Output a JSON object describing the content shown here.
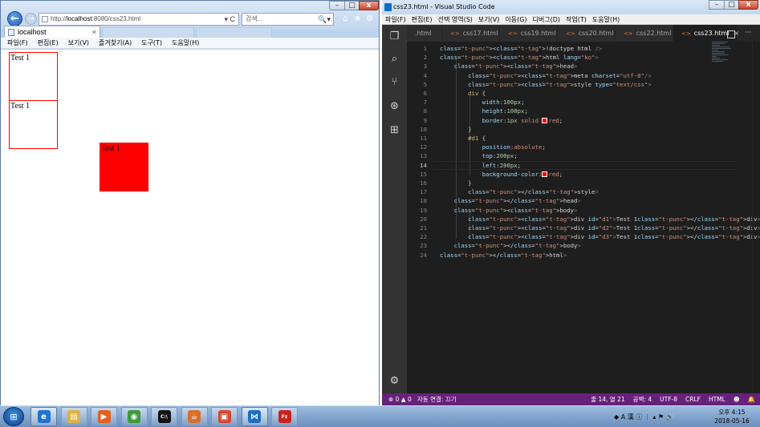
{
  "ie": {
    "address_prefix": "http://",
    "address_host": "localhost",
    "address_rest": ":8080/css23.html",
    "address_ctrl": "▾ C",
    "search_placeholder": "검색...",
    "search_ctrl": "🔍▾",
    "tab_title": "localhost",
    "tab_close": "×",
    "menu": [
      "파일(F)",
      "편집(E)",
      "보기(V)",
      "즐겨찾기(A)",
      "도구(T)",
      "도움말(H)"
    ],
    "boxes": [
      "Test 1",
      "Test 1",
      "Test 1"
    ],
    "box_color": "#ff0000"
  },
  "vscode": {
    "title": "css23.html - Visual Studio Code",
    "menu": [
      "파일(F)",
      "편집(E)",
      "선택 영역(S)",
      "보기(V)",
      "이동(G)",
      "디버그(D)",
      "작업(T)",
      "도움말(H)"
    ],
    "tabs": [
      {
        "label": ".html",
        "active": false
      },
      {
        "label": "css17.html",
        "active": false
      },
      {
        "label": "css19.html",
        "active": false
      },
      {
        "label": "css20.html",
        "active": false
      },
      {
        "label": "css22.html",
        "active": false
      },
      {
        "label": "css23.html",
        "active": true
      }
    ],
    "tab_brackets": "<>",
    "tab_close": "×",
    "code_lines": [
      "<!doctype html />",
      "<html lang=\"ko\">",
      "    <head>",
      "        <meta charset=\"utf-8\"/>",
      "        <style type=\"text/css\">",
      "        div {",
      "            width:100px;",
      "            height:100px;",
      "            border:1px solid red;",
      "        }",
      "        #d1 {",
      "            position:absolute;",
      "            top:200px;",
      "            left:200px;",
      "            background-color:red;",
      "        }",
      "        </style>",
      "    </head>",
      "    <body>",
      "        <div id=\"d1\">Test 1</div>",
      "        <div id=\"d2\">Test 1</div>",
      "        <div id=\"d3\">Test 1</div>",
      "    </body>",
      "</html>"
    ],
    "current_line": 14,
    "status": {
      "problems": "⊗ 0 ▲ 0",
      "autoconnect": "자동 연결: 끄기",
      "position": "줄 14, 열 21",
      "indent": "공백: 4",
      "encoding": "UTF-8",
      "eol": "CRLF",
      "language": "HTML",
      "feedback": "☻",
      "bell": "🔔"
    },
    "status_color": "#68217a"
  },
  "taskbar": {
    "apps": [
      {
        "name": "internet-explorer",
        "glyph": "e",
        "color": "#1f74d1",
        "active": true
      },
      {
        "name": "file-explorer",
        "glyph": "▤",
        "color": "#e0b13c",
        "active": false
      },
      {
        "name": "media-player",
        "glyph": "▶",
        "color": "#e8601e",
        "active": false
      },
      {
        "name": "chrome",
        "glyph": "◉",
        "color": "#3a9a3a",
        "active": false
      },
      {
        "name": "command-prompt",
        "glyph": "C:\\",
        "color": "#111111",
        "active": false
      },
      {
        "name": "java",
        "glyph": "☕",
        "color": "#d96f2a",
        "active": false
      },
      {
        "name": "eclipse-editor",
        "glyph": "▣",
        "color": "#d9462a",
        "active": false
      },
      {
        "name": "vscode",
        "glyph": "⋈",
        "color": "#1c6fc2",
        "active": true
      },
      {
        "name": "filezilla",
        "glyph": "Fz",
        "color": "#c9211e",
        "active": false
      }
    ],
    "tray": "◆ A 漢 ⓘ ⋮ ▴ ⚑ 🔊",
    "clock_time": "오후 4:15",
    "clock_date": "2018-05-16"
  }
}
